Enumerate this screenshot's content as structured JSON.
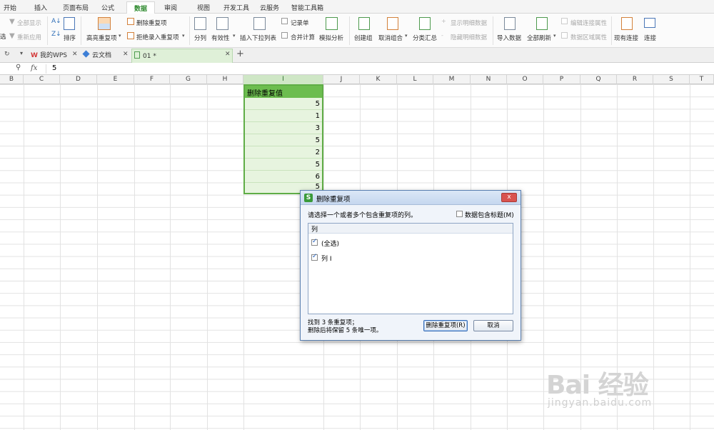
{
  "ribbon_tabs": [
    "开始",
    "插入",
    "页面布局",
    "公式",
    "数据",
    "审阅",
    "视图",
    "开发工具",
    "云服务",
    "智能工具箱"
  ],
  "active_tab": "数据",
  "ribbon": {
    "show_all": "全部显示",
    "reapply": "重新应用",
    "sort": "排序",
    "highlight_dup": "高亮重复项",
    "remove_dup": "删除重复项",
    "reject_dup": "拒绝录入重复项",
    "split": "分列",
    "validity": "有效性",
    "insert_dropdown": "插入下拉列表",
    "record_form": "记录单",
    "consolidate": "合并计算",
    "simulate": "模拟分析",
    "create_group": "创建组",
    "ungroup": "取消组合",
    "subtotal": "分类汇总",
    "show_detail": "显示明细数据",
    "hide_detail": "隐藏明细数据",
    "import_data": "导入数据",
    "refresh_all": "全部刷新",
    "edit_conn": "编辑连接属性",
    "data_area": "数据区域属性",
    "existing_conn": "现有连接",
    "connect": "连接",
    "filter_partial": "选",
    "apply_partial": "选"
  },
  "doc_tabs": {
    "mywps": "我的WPS",
    "cloud": "云文档",
    "file": "01 *",
    "add": "+"
  },
  "formula_bar": {
    "value": "5",
    "fx": "fx"
  },
  "columns": [
    "B",
    "C",
    "D",
    "E",
    "F",
    "G",
    "H",
    "I",
    "J",
    "K",
    "L",
    "M",
    "N",
    "O",
    "P",
    "Q",
    "R",
    "S",
    "T"
  ],
  "selected_column": "I",
  "sheet": {
    "header": "删除重复值",
    "values": [
      "5",
      "1",
      "3",
      "5",
      "2",
      "5",
      "6",
      "5"
    ]
  },
  "dialog": {
    "title": "删除重复项",
    "close": "x",
    "instruction": "请选择一个或者多个包含重复项的列。",
    "header_checkbox_label": "数据包含标题(M)",
    "header_checkbox_checked": false,
    "list_header": "列",
    "items": [
      {
        "label": "(全选)",
        "checked": true
      },
      {
        "label": "列 I",
        "checked": true
      }
    ],
    "found_line1": "找到 3 条重复项；",
    "found_line2": "删除后将保留 5 条唯一项。",
    "ok_button": "删除重复项(R)",
    "cancel_button": "取消"
  },
  "watermark": {
    "brand": "Bai 经验",
    "url": "jingyan.baidu.com"
  },
  "colors": {
    "accent_green": "#5fad46",
    "selection_fill": "#e7f4df",
    "dialog_border": "#5a7fb0"
  }
}
